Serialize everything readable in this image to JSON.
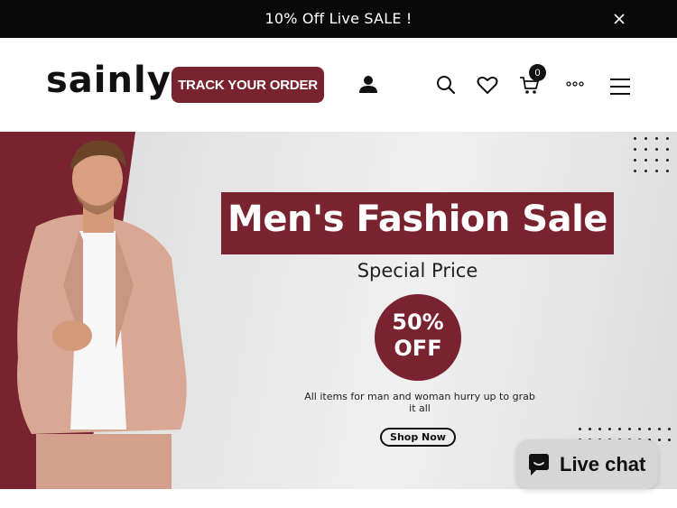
{
  "announcement": {
    "text": "10% Off Live SALE !"
  },
  "header": {
    "logo": "sainly",
    "track_order_label": "TRACK YOUR ORDER",
    "cart_count": "0"
  },
  "hero": {
    "title": "Men's Fashion Sale",
    "subtitle": "Special Price",
    "discount_line1": "50%",
    "discount_line2": "OFF",
    "description": "All items for man and woman  hurry up to grab it all",
    "cta_label": "Shop Now"
  },
  "live_chat": {
    "label": "Live chat"
  },
  "icons": [
    "close-icon",
    "account-icon",
    "search-icon",
    "wishlist-heart-icon",
    "cart-icon",
    "more-options-icon",
    "hamburger-menu-icon",
    "chat-bubble-icon"
  ],
  "colors": {
    "brand": "#7a2330",
    "announcement_bg": "#0a0a0a"
  }
}
